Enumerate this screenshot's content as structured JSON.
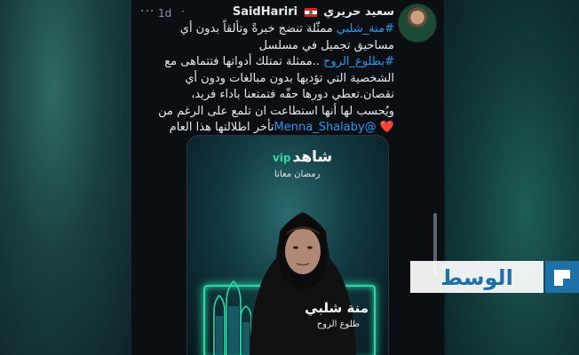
{
  "tweet": {
    "user_name_latin": "SaidHariri",
    "user_name_arabic": "سعيد حريري",
    "flag": "lebanon-flag",
    "time": "1d",
    "menu": "···",
    "separator": "·",
    "lines": [
      "#منة_شلبي ممثّلة تنضج خبرةً وتألقاً بدون أي",
      "مساحيق تجميل في مسلسل",
      "#بطلوع_الروح ..ممثلة تمتلك أدواتها فتتماهى مع",
      "الشخصية التي تؤديها بدون مبالغات ودون أي",
      "نقصان.تعطي دورها حقّه فتمتعنا باداء فريد،",
      "ويُحسب لها أنها استطاعت ان تلمع على الرغم من",
      "تأخر اطلالتها هذا العام"
    ],
    "hashtag_1": "#منة_شلبي",
    "hashtag_2": "#بطلوع_الروح",
    "mention": "@Menna_Shalaby",
    "heart": "❤️"
  },
  "media": {
    "logo_text": "شاهد",
    "logo_vip": "vip",
    "tagline": "رمضان معانا",
    "actor_name": "منة شلبي",
    "series_name": "طلوع الروح"
  },
  "watermark": {
    "text": "الوسط"
  },
  "colors": {
    "link": "#1d9bf0",
    "neon": "#28d9a5",
    "tweet_bg": "#0b0f14"
  }
}
